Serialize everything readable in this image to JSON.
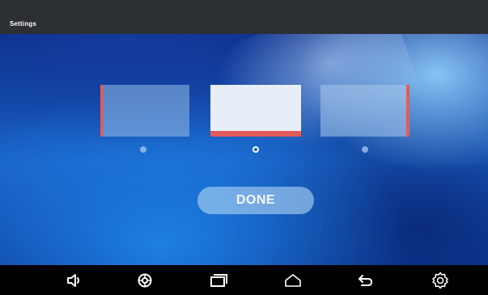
{
  "window": {
    "title": "Settings"
  },
  "main": {
    "thumbnails": [
      {
        "name": "left"
      },
      {
        "name": "center",
        "selected": true
      },
      {
        "name": "right"
      }
    ],
    "page_indicator": {
      "count": 3,
      "selected_index": 1
    },
    "done_label": "DONE"
  },
  "nav_bar": {
    "buttons": [
      {
        "icon": "volume-icon"
      },
      {
        "icon": "settings-wheel-icon"
      },
      {
        "icon": "recent-apps-icon"
      },
      {
        "icon": "home-icon"
      },
      {
        "icon": "back-icon"
      },
      {
        "icon": "gear-icon"
      }
    ]
  },
  "colors": {
    "title_bar": "#2c2f34",
    "accent": "#e25a5a",
    "nav_bar": "#000000",
    "background_blue": "#1a63c7"
  }
}
